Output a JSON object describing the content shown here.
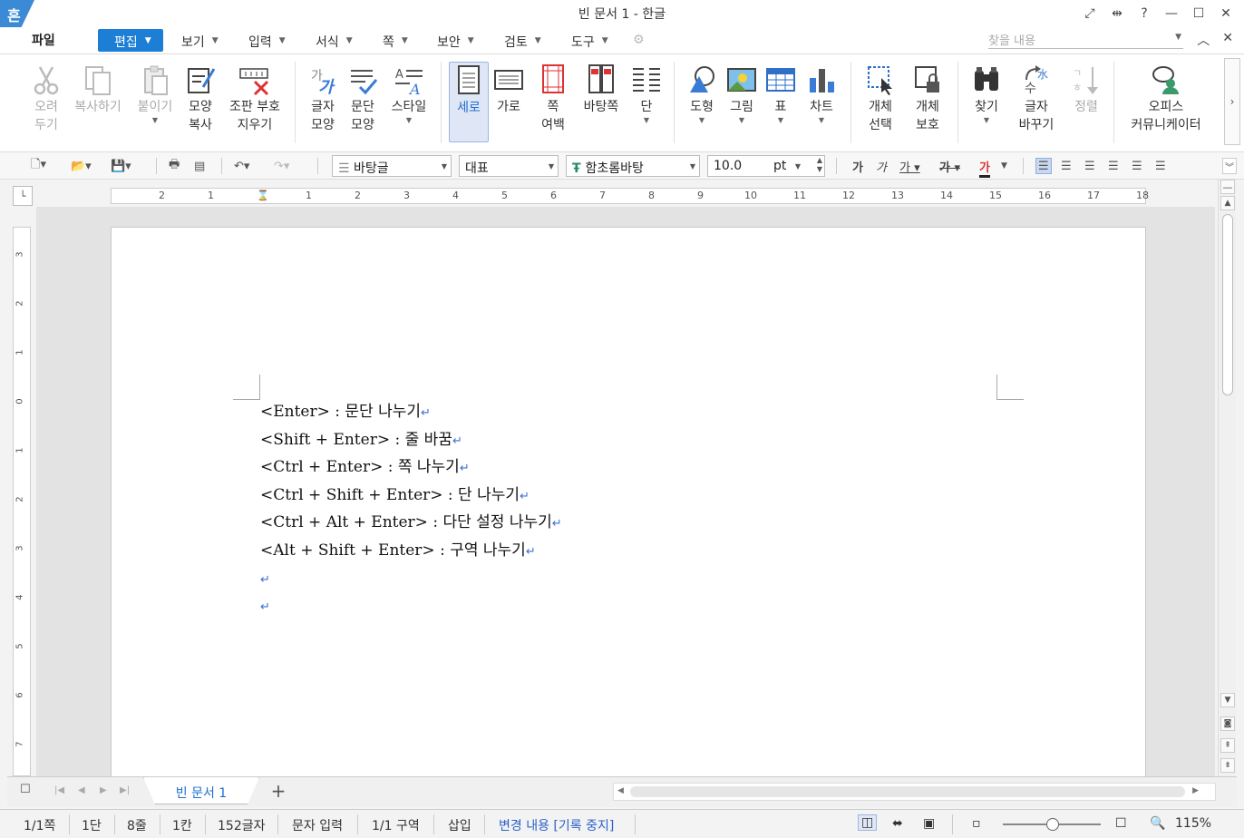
{
  "window": {
    "logo": "흔",
    "title": "빈 문서 1 - 한글"
  },
  "menu": {
    "file": "파일",
    "items": [
      "편집",
      "보기",
      "입력",
      "서식",
      "쪽",
      "보안",
      "검토",
      "도구"
    ],
    "search_placeholder": "찾을 내용"
  },
  "ribbon": {
    "cut": "오려\n두기",
    "copy": "복사하기",
    "paste": "붙이기",
    "shape_copy": "모양\n복사",
    "clear_marks": "조판 부호\n지우기",
    "char_shape": "글자\n모양",
    "para_shape": "문단\n모양",
    "style": "스타일",
    "portrait": "세로",
    "landscape": "가로",
    "page_margin": "쪽\n여백",
    "master_page": "바탕쪽",
    "column": "단",
    "shape": "도형",
    "picture": "그림",
    "table": "표",
    "chart": "차트",
    "obj_select": "개체\n선택",
    "obj_protect": "개체\n보호",
    "find": "찾기",
    "replace": "글자\n바꾸기",
    "sort": "정렬",
    "office_comm": "오피스\n커뮤니케이터"
  },
  "format": {
    "style_name": "바탕글",
    "lang": "대표",
    "font": "함초롬바탕",
    "size": "10.0",
    "unit": "pt"
  },
  "ruler": {
    "h_ticks": [
      "2",
      "1",
      "1",
      "2",
      "3",
      "4",
      "5",
      "6",
      "7",
      "8",
      "9",
      "10",
      "11",
      "12",
      "13",
      "14",
      "15",
      "16",
      "17",
      "18"
    ],
    "v_ticks": [
      "3",
      "2",
      "1",
      "0",
      "1",
      "2",
      "3",
      "4",
      "5",
      "6",
      "7"
    ]
  },
  "document": {
    "lines": [
      "<Enter> : 문단 나누기",
      "<Shift + Enter> : 줄 바꿈",
      "<Ctrl + Enter> : 쪽 나누기",
      "<Ctrl + Shift + Enter> : 단 나누기",
      "<Ctrl + Alt + Enter> : 다단 설정 나누기",
      "<Alt + Shift + Enter> : 구역 나누기",
      "",
      ""
    ],
    "para_mark": "↵"
  },
  "tabs": {
    "doc_tab": "빈 문서 1",
    "add": "+"
  },
  "status": {
    "page": "1/1쪽",
    "column": "1단",
    "line": "8줄",
    "col": "1칸",
    "chars": "152글자",
    "mode": "문자 입력",
    "section": "1/1 구역",
    "insert": "삽입",
    "track": "변경 내용 [기록 중지]",
    "zoom": "115%"
  },
  "colors": {
    "accent": "#1d7ed6",
    "track_text": "#2a62c9",
    "para_mark": "#3a6fd8"
  }
}
